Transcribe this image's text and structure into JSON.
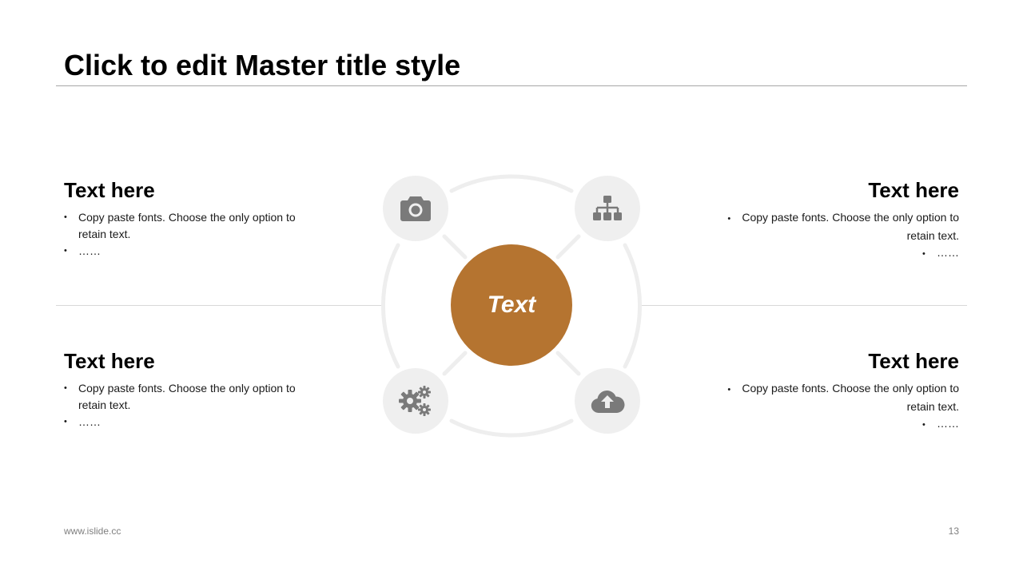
{
  "slide": {
    "title": "Click to edit Master title style",
    "footer_url": "www.islide.cc",
    "page_number": "13"
  },
  "center": {
    "label": "Text"
  },
  "blocks": {
    "top_left": {
      "heading": "Text here",
      "bullets": [
        "Copy paste fonts. Choose the only option to retain text.",
        "……"
      ]
    },
    "top_right": {
      "heading": "Text here",
      "bullets": [
        "Copy paste fonts. Choose the only option to retain text.",
        "……"
      ]
    },
    "bottom_left": {
      "heading": "Text here",
      "bullets": [
        "Copy paste fonts. Choose the only option to retain text.",
        "……"
      ]
    },
    "bottom_right": {
      "heading": "Text here",
      "bullets": [
        "Copy paste fonts. Choose the only option to retain text.",
        "……"
      ]
    }
  },
  "icons": [
    "camera-icon",
    "hierarchy-icon",
    "gears-icon",
    "cloud-upload-icon"
  ],
  "colors": {
    "accent": "#b57430",
    "icon": "#7a7a7a",
    "icon_bg": "#efefef",
    "ring": "#eeeeee"
  }
}
